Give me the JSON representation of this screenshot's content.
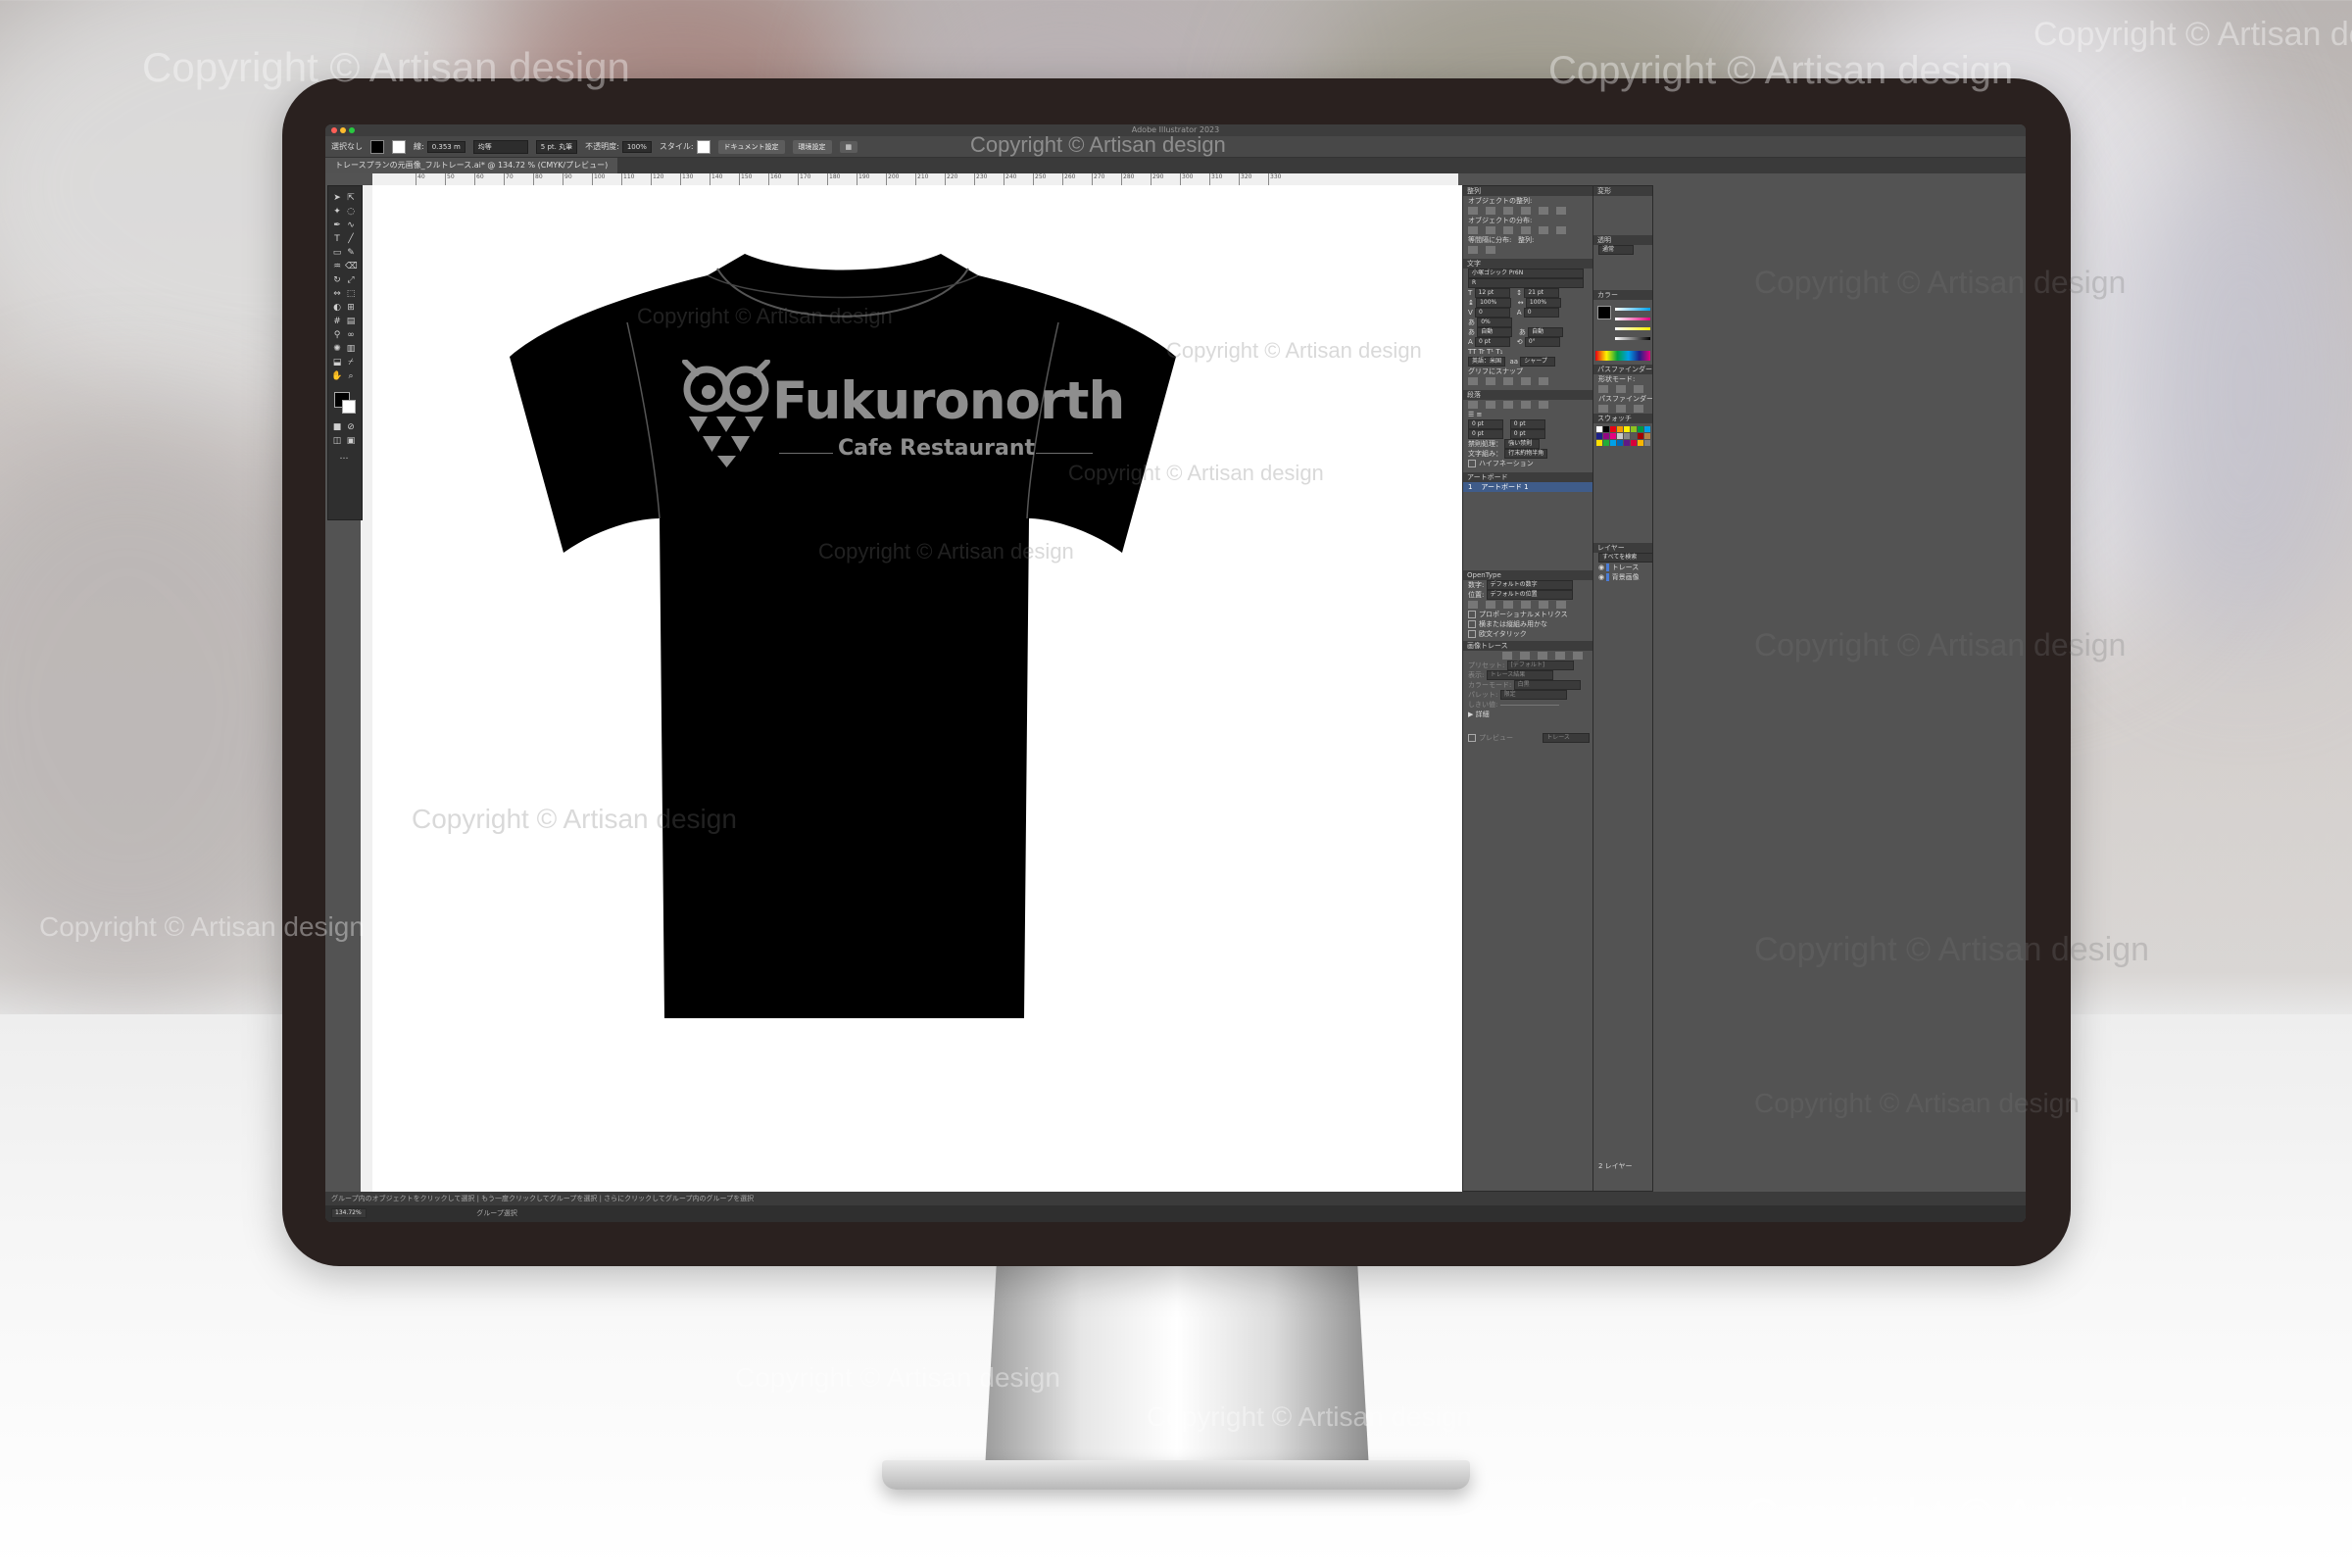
{
  "app": {
    "title": "Adobe Illustrator 2023",
    "document_tab": "トレースプランの元画像_フルトレース.ai* @ 134.72 % (CMYK/プレビュー)"
  },
  "control_bar": {
    "selection_label": "選択なし",
    "stroke_label": "線:",
    "stroke_value": "0.353 m",
    "stroke_profile": "均等",
    "brush_label": "5 pt. 丸筆",
    "opacity_label": "不透明度:",
    "opacity_value": "100%",
    "style_label": "スタイル:",
    "doc_setup_button": "ドキュメント設定",
    "preferences_button": "環境設定"
  },
  "ruler_ticks": [
    "40",
    "50",
    "60",
    "70",
    "80",
    "90",
    "100",
    "110",
    "120",
    "130",
    "140",
    "150",
    "160",
    "170",
    "180",
    "190",
    "200",
    "210",
    "220",
    "230",
    "240",
    "250",
    "260",
    "270",
    "280",
    "290",
    "300",
    "310",
    "320",
    "330"
  ],
  "artwork": {
    "brand_name": "Fukuronorth",
    "tagline": "Cafe Restaurant",
    "shirt_color": "#000000",
    "logo_color": "#8e8e8e"
  },
  "watermark": {
    "prefix": "Copyright",
    "symbol": "©",
    "brand": "Artisan",
    "suffix": "design"
  },
  "panels": {
    "align": {
      "title": "整列",
      "align_objects": "オブジェクトの整列:",
      "distribute_objects": "オブジェクトの分布:",
      "distribute_spacing": "等間隔に分布:",
      "align_to": "整列:"
    },
    "character": {
      "title": "文字",
      "font": "小塚ゴシック Pr6N",
      "style": "R",
      "font_size": "12 pt",
      "leading": "21 pt",
      "vscale": "100%",
      "hscale": "100%",
      "kerning": "0",
      "tracking": "0",
      "tsume": "0%",
      "auto1": "自動",
      "auto2": "自動",
      "baseline": "0 pt",
      "rotation": "0°",
      "language": "英語：米国",
      "antialias": "シャープ",
      "snap": "グリフにスナップ"
    },
    "paragraph": {
      "title": "段落",
      "indent1": "0 pt",
      "indent2": "0 pt",
      "indent3": "0 pt",
      "indent4": "0 pt",
      "kinsoku": "禁則処理：",
      "kinsoku_value": "強い禁則",
      "mojikumi": "文字組み：",
      "mojikumi_value": "行末約物半角",
      "hyphenation": "ハイフネーション"
    },
    "artboards": {
      "title": "アートボード",
      "items": [
        {
          "index": "1",
          "name": "アートボード 1"
        }
      ]
    },
    "opentype": {
      "title": "OpenType",
      "figure_label": "数字:",
      "figure_value": "デフォルトの数字",
      "position_label": "位置:",
      "position_value": "デフォルトの位置",
      "options": [
        "プロポーショナルメトリクス",
        "横または縦組み用かな",
        "欧文イタリック"
      ]
    },
    "image_trace": {
      "title": "画像トレース",
      "preset_label": "プリセット:",
      "preset_value": "[デフォルト]",
      "view_label": "表示:",
      "view_value": "トレース結果",
      "mode_label": "カラーモード:",
      "mode_value": "白黒",
      "palette_label": "パレット:",
      "palette_value": "限定",
      "threshold_label": "しきい値:",
      "details": "詳細",
      "preview": "プレビュー",
      "trace_button": "トレース"
    },
    "transform": {
      "title": "変形"
    },
    "appearance": {
      "title": "透明",
      "mode": "通常"
    },
    "color": {
      "title": "カラー"
    },
    "pathfinder": {
      "title": "パスファインダー",
      "shape_modes": "形状モード:",
      "pathfinders": "パスファインダー:"
    },
    "swatches": {
      "title": "スウォッチ"
    },
    "layers": {
      "title": "レイヤー",
      "search_placeholder": "すべてを検索",
      "items": [
        "トレース",
        "背景画像"
      ],
      "footer": "2 レイヤー"
    }
  },
  "status": {
    "hint": "グループ内のオブジェクトをクリックして選択 | もう一度クリックしてグループを選択 | さらにクリックしてグループ内のグループを選択",
    "zoom": "134.72%",
    "mode": "グループ選択"
  }
}
